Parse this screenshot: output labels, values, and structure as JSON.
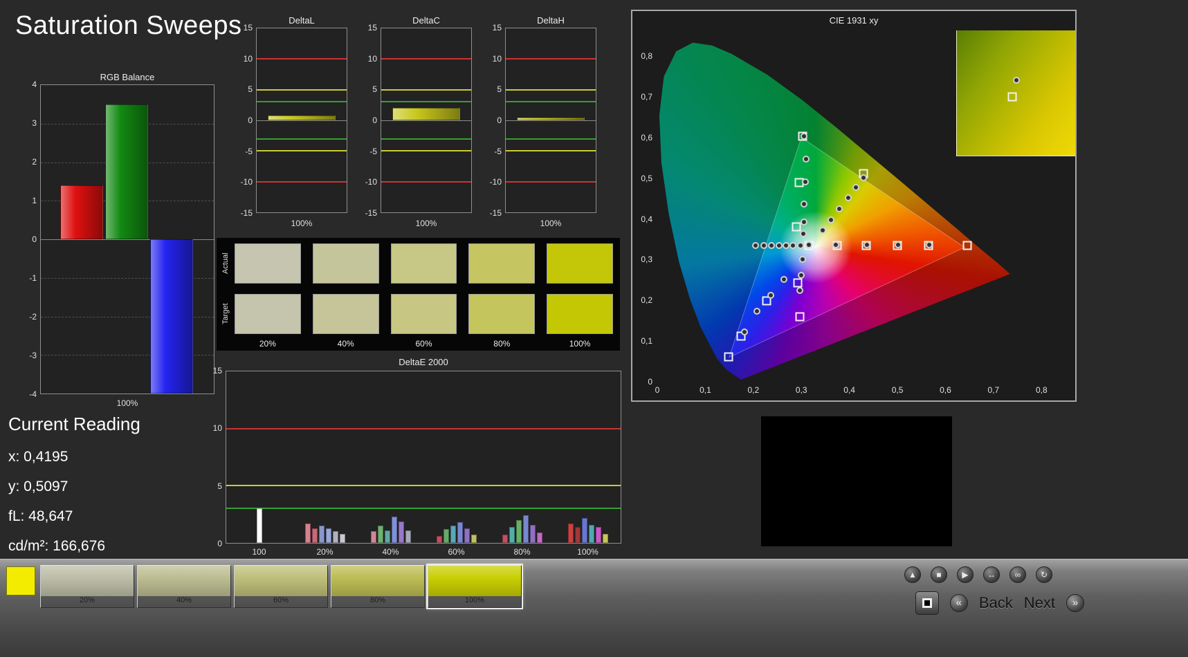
{
  "page": {
    "title": "Saturation Sweeps"
  },
  "current_reading": {
    "heading": "Current Reading",
    "x": "x: 0,4195",
    "y": "y: 0,5097",
    "fl": "fL: 48,647",
    "cdm2": "cd/m²: 166,676"
  },
  "chart_data": [
    {
      "id": "rgb_balance",
      "type": "bar",
      "title": "RGB Balance",
      "ylim": [
        -4,
        4
      ],
      "yticks": [
        4,
        3,
        2,
        1,
        0,
        -1,
        -2,
        -3,
        -4
      ],
      "categories": [
        "100%"
      ],
      "series": [
        {
          "name": "red",
          "color": "#e01010",
          "value": 1.4
        },
        {
          "name": "green",
          "color": "#128a12",
          "value": 3.5
        },
        {
          "name": "blue",
          "color": "#2424f0",
          "value": -4.0
        }
      ]
    },
    {
      "id": "deltaL",
      "type": "bar",
      "title": "DeltaL",
      "ylim": [
        -15,
        15
      ],
      "yticks": [
        15,
        10,
        5,
        0,
        -5,
        -10,
        -15
      ],
      "xlabel": "100%",
      "value": 0.8,
      "bar_color": "#c8c81e",
      "limits": [
        {
          "y": 10,
          "color": "#cc3333"
        },
        {
          "y": 5,
          "color": "#cccc33"
        },
        {
          "y": 3,
          "color": "#33a033"
        },
        {
          "y": -3,
          "color": "#33a033"
        },
        {
          "y": -5,
          "color": "#cccc33"
        },
        {
          "y": -10,
          "color": "#cc3333"
        }
      ]
    },
    {
      "id": "deltaC",
      "type": "bar",
      "title": "DeltaC",
      "ylim": [
        -15,
        15
      ],
      "yticks": [
        15,
        10,
        5,
        0,
        -5,
        -10,
        -15
      ],
      "xlabel": "100%",
      "value": 2.0,
      "bar_color": "#c8c81e",
      "limits": [
        {
          "y": 10,
          "color": "#cc3333"
        },
        {
          "y": 5,
          "color": "#cccc33"
        },
        {
          "y": 3,
          "color": "#33a033"
        },
        {
          "y": -3,
          "color": "#33a033"
        },
        {
          "y": -5,
          "color": "#cccc33"
        },
        {
          "y": -10,
          "color": "#cc3333"
        }
      ]
    },
    {
      "id": "deltaH",
      "type": "bar",
      "title": "DeltaH",
      "ylim": [
        -15,
        15
      ],
      "yticks": [
        15,
        10,
        5,
        0,
        -5,
        -10,
        -15
      ],
      "xlabel": "100%",
      "value": 0.5,
      "bar_color": "#c8c81e",
      "limits": [
        {
          "y": 10,
          "color": "#cc3333"
        },
        {
          "y": 5,
          "color": "#cccc33"
        },
        {
          "y": 3,
          "color": "#33a033"
        },
        {
          "y": -3,
          "color": "#33a033"
        },
        {
          "y": -5,
          "color": "#cccc33"
        },
        {
          "y": -10,
          "color": "#cc3333"
        }
      ]
    },
    {
      "id": "deltae2000",
      "type": "bar",
      "title": "DeltaE 2000",
      "ylim": [
        0,
        15
      ],
      "yticks": [
        15,
        10,
        5,
        0
      ],
      "limits": [
        {
          "y": 10,
          "color": "#cc3333"
        },
        {
          "y": 5,
          "color": "#cccc33"
        },
        {
          "y": 3,
          "color": "#33a033"
        }
      ],
      "groups": [
        {
          "label": "100",
          "bars": [
            {
              "color": "#ffffff",
              "value": 3.0
            }
          ]
        },
        {
          "label": "20%",
          "bars": [
            {
              "color": "#d88090",
              "value": 1.7
            },
            {
              "color": "#c86878",
              "value": 1.3
            },
            {
              "color": "#8898c8",
              "value": 1.5
            },
            {
              "color": "#98a8d8",
              "value": 1.3
            },
            {
              "color": "#b0b0c0",
              "value": 1.0
            },
            {
              "color": "#c8c8d0",
              "value": 0.8
            }
          ]
        },
        {
          "label": "40%",
          "bars": [
            {
              "color": "#d08898",
              "value": 1.0
            },
            {
              "color": "#70b070",
              "value": 1.5
            },
            {
              "color": "#60a8a0",
              "value": 1.1
            },
            {
              "color": "#8090d8",
              "value": 2.3
            },
            {
              "color": "#9878c8",
              "value": 1.9
            },
            {
              "color": "#a8a8b8",
              "value": 1.1
            }
          ]
        },
        {
          "label": "60%",
          "bars": [
            {
              "color": "#c05060",
              "value": 0.6
            },
            {
              "color": "#68aa68",
              "value": 1.2
            },
            {
              "color": "#58a8b8",
              "value": 1.5
            },
            {
              "color": "#7888d0",
              "value": 1.8
            },
            {
              "color": "#9070c0",
              "value": 1.3
            },
            {
              "color": "#c0c060",
              "value": 0.7
            }
          ]
        },
        {
          "label": "80%",
          "bars": [
            {
              "color": "#c05060",
              "value": 0.7
            },
            {
              "color": "#50b0a8",
              "value": 1.4
            },
            {
              "color": "#68b068",
              "value": 2.0
            },
            {
              "color": "#7888d0",
              "value": 2.4
            },
            {
              "color": "#9070c0",
              "value": 1.6
            },
            {
              "color": "#c868c8",
              "value": 0.9
            }
          ]
        },
        {
          "label": "100%",
          "bars": [
            {
              "color": "#d04040",
              "value": 1.7
            },
            {
              "color": "#a03838",
              "value": 1.4
            },
            {
              "color": "#6878d0",
              "value": 2.2
            },
            {
              "color": "#50a8b0",
              "value": 1.6
            },
            {
              "color": "#c858c8",
              "value": 1.4
            },
            {
              "color": "#c8c858",
              "value": 0.8
            }
          ]
        }
      ]
    },
    {
      "id": "cie1931",
      "type": "scatter",
      "title": "CIE 1931 xy",
      "xlim": [
        0,
        0.85
      ],
      "ylim": [
        0,
        0.86
      ],
      "xticks": [
        "0",
        "0,1",
        "0,2",
        "0,3",
        "0,4",
        "0,5",
        "0,6",
        "0,7",
        "0,8"
      ],
      "yticks": [
        "0",
        "0,1",
        "0,2",
        "0,3",
        "0,4",
        "0,5",
        "0,6",
        "0,7",
        "0,8"
      ],
      "gamut_triangle": [
        [
          0.64,
          0.33
        ],
        [
          0.3,
          0.6
        ],
        [
          0.15,
          0.06
        ]
      ],
      "measured_points": [
        [
          0.205,
          0.334
        ],
        [
          0.222,
          0.334
        ],
        [
          0.238,
          0.334
        ],
        [
          0.253,
          0.334
        ],
        [
          0.268,
          0.334
        ],
        [
          0.283,
          0.334
        ],
        [
          0.298,
          0.334
        ],
        [
          0.316,
          0.336
        ],
        [
          0.372,
          0.336
        ],
        [
          0.437,
          0.336
        ],
        [
          0.502,
          0.336
        ],
        [
          0.566,
          0.336
        ],
        [
          0.306,
          0.604
        ],
        [
          0.31,
          0.547
        ],
        [
          0.308,
          0.492
        ],
        [
          0.306,
          0.437
        ],
        [
          0.305,
          0.392
        ],
        [
          0.304,
          0.363
        ],
        [
          0.344,
          0.372
        ],
        [
          0.361,
          0.398
        ],
        [
          0.379,
          0.425
        ],
        [
          0.397,
          0.452
        ],
        [
          0.414,
          0.478
        ],
        [
          0.429,
          0.502
        ],
        [
          0.302,
          0.3
        ],
        [
          0.299,
          0.262
        ],
        [
          0.297,
          0.224
        ],
        [
          0.263,
          0.252
        ],
        [
          0.236,
          0.213
        ],
        [
          0.208,
          0.173
        ],
        [
          0.181,
          0.123
        ]
      ],
      "target_points": [
        [
          0.316,
          0.335
        ],
        [
          0.375,
          0.335
        ],
        [
          0.435,
          0.335
        ],
        [
          0.5,
          0.335
        ],
        [
          0.565,
          0.335
        ],
        [
          0.645,
          0.335
        ],
        [
          0.302,
          0.603
        ],
        [
          0.296,
          0.489
        ],
        [
          0.29,
          0.38
        ],
        [
          0.43,
          0.512
        ],
        [
          0.292,
          0.243
        ],
        [
          0.297,
          0.16
        ],
        [
          0.227,
          0.199
        ],
        [
          0.175,
          0.112
        ],
        [
          0.149,
          0.062
        ]
      ]
    }
  ],
  "cie_inset": {
    "markers": [
      {
        "type": "circle",
        "x": 0.5,
        "y": 0.4
      },
      {
        "type": "square",
        "x": 0.47,
        "y": 0.53
      }
    ]
  },
  "swatch_panel": {
    "col_labels": [
      "20%",
      "40%",
      "60%",
      "80%",
      "100%"
    ],
    "rows": [
      {
        "name": "Actual",
        "colors": [
          "#c5c5b0",
          "#c5c59c",
          "#c7c786",
          "#c5c562",
          "#c3c708"
        ]
      },
      {
        "name": "Target",
        "colors": [
          "#c5c5ad",
          "#c5c599",
          "#c7c783",
          "#c5c55e",
          "#c3c704"
        ]
      }
    ]
  },
  "toolbar": {
    "pattern_color": "#f4ec00",
    "swatches": [
      {
        "label": "20%",
        "color": "#bdbda8",
        "selected": false
      },
      {
        "label": "40%",
        "color": "#bdbd93",
        "selected": false
      },
      {
        "label": "60%",
        "color": "#bfbf7b",
        "selected": false
      },
      {
        "label": "80%",
        "color": "#bdbd55",
        "selected": false
      },
      {
        "label": "100%",
        "color": "#c9cf04",
        "selected": true
      }
    ],
    "icons": [
      {
        "name": "eject-icon",
        "glyph": "▲"
      },
      {
        "name": "stop-icon",
        "glyph": "■"
      },
      {
        "name": "play-icon",
        "glyph": "▶"
      },
      {
        "name": "fit-width-icon",
        "glyph": "↔"
      },
      {
        "name": "loop-icon",
        "glyph": "∞"
      },
      {
        "name": "sync-icon",
        "glyph": "↻"
      }
    ],
    "prev_glyph": "«",
    "next_glyph": "»",
    "back_label": "Back",
    "next_label": "Next"
  }
}
